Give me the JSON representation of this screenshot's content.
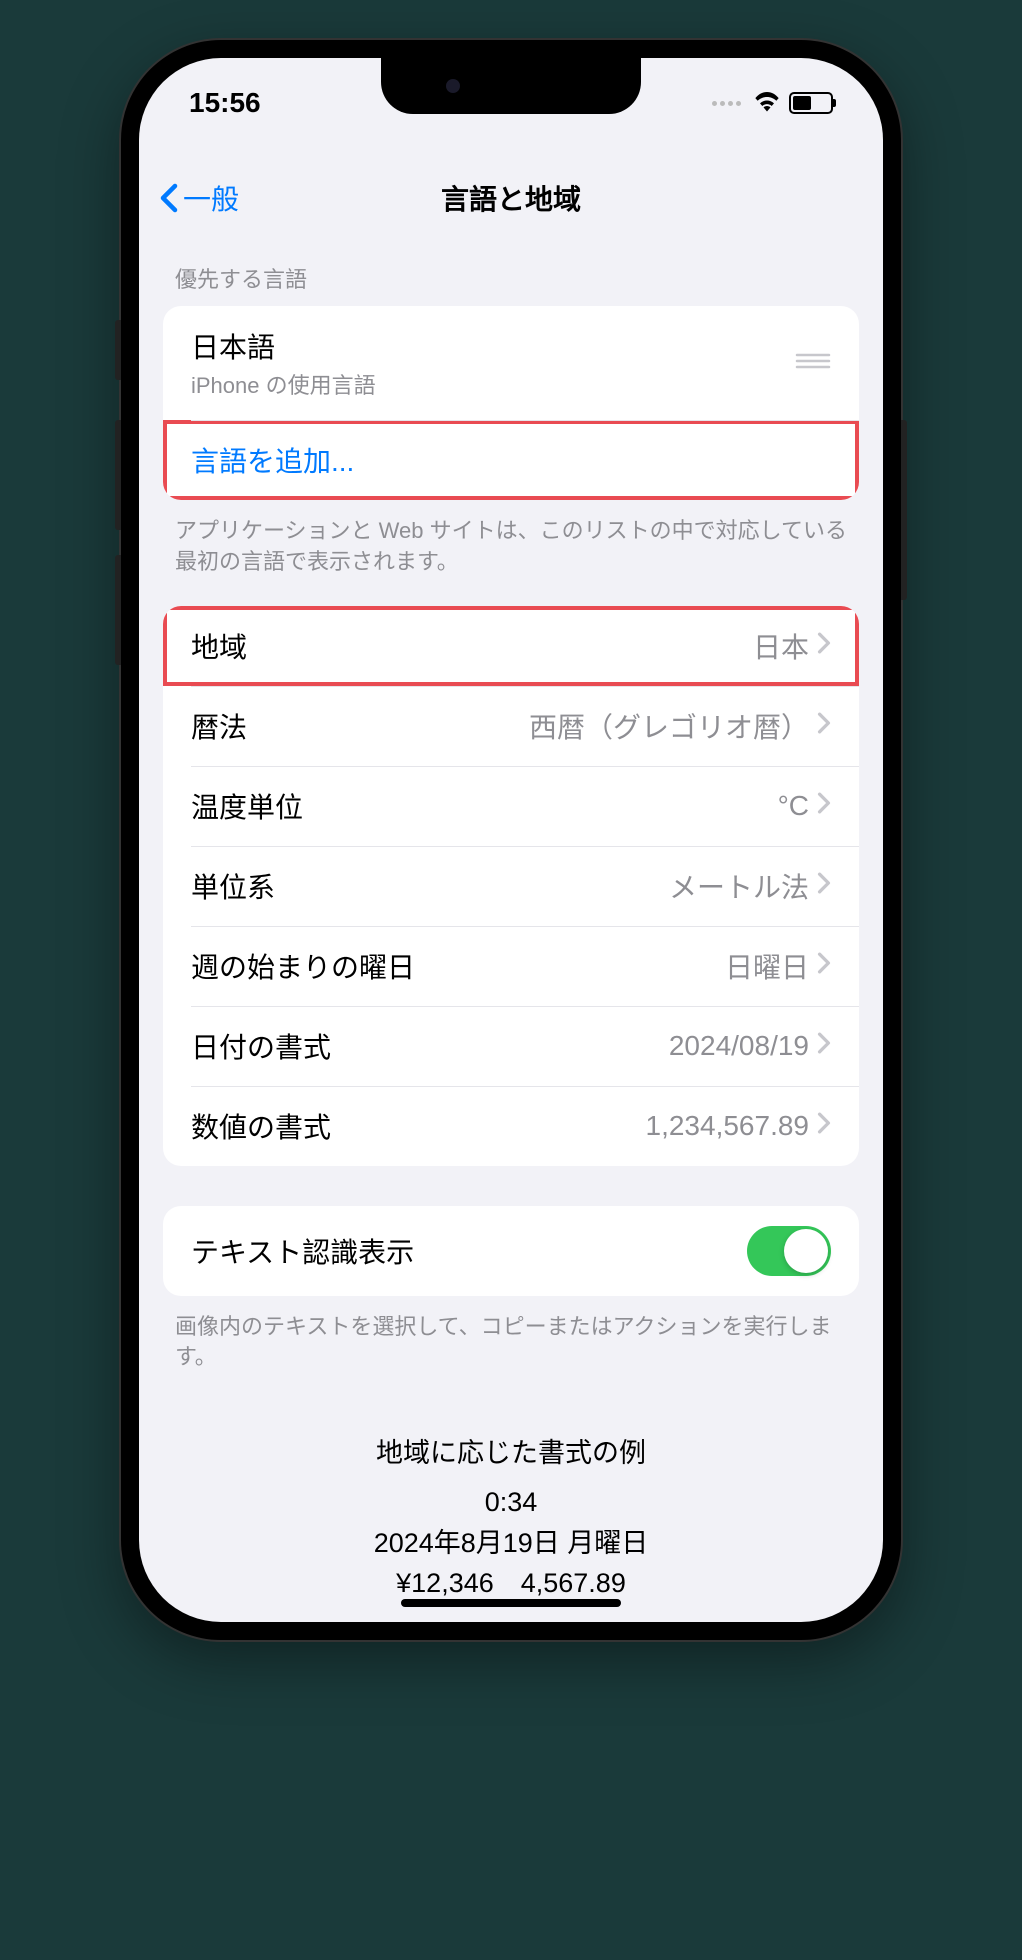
{
  "status": {
    "time": "15:56"
  },
  "nav": {
    "back_label": "一般",
    "title": "言語と地域"
  },
  "languages": {
    "header": "優先する言語",
    "primary": {
      "name": "日本語",
      "subtitle": "iPhone の使用言語"
    },
    "add_label": "言語を追加...",
    "footer": "アプリケーションと Web サイトは、このリストの中で対応している最初の言語で表示されます。"
  },
  "settings": {
    "region": {
      "label": "地域",
      "value": "日本"
    },
    "calendar": {
      "label": "暦法",
      "value": "西暦（グレゴリオ暦）"
    },
    "temperature": {
      "label": "温度単位",
      "value": "°C"
    },
    "units": {
      "label": "単位系",
      "value": "メートル法"
    },
    "week_start": {
      "label": "週の始まりの曜日",
      "value": "日曜日"
    },
    "date_format": {
      "label": "日付の書式",
      "value": "2024/08/19"
    },
    "number_format": {
      "label": "数値の書式",
      "value": "1,234,567.89"
    }
  },
  "live_text": {
    "label": "テキスト認識表示",
    "footer": "画像内のテキストを選択して、コピーまたはアクションを実行します。"
  },
  "example": {
    "title": "地域に応じた書式の例",
    "time": "0:34",
    "date": "2024年8月19日 月曜日",
    "numbers": "¥12,346　4,567.89"
  }
}
